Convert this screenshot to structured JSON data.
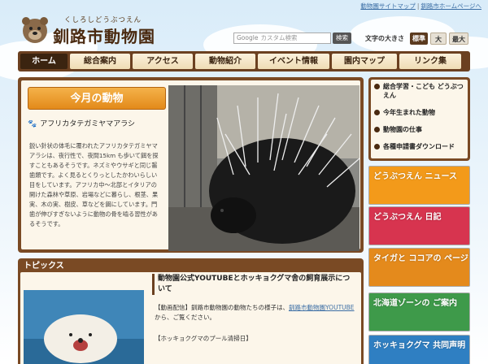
{
  "header": {
    "toplinks": [
      "動物園サイトマップ",
      "釧路市ホームページへ"
    ],
    "logo_ruby": "くしろしどうぶつえん",
    "logo_name": "釧路市動物園",
    "search_brand": "Google",
    "search_placeholder": "カスタム検索",
    "search_button": "検索",
    "fontsize_label": "文字の大きさ",
    "fontsize_options": [
      "標準",
      "大",
      "最大"
    ]
  },
  "nav": {
    "items": [
      "ホーム",
      "総合案内",
      "アクセス",
      "動物紹介",
      "イベント情報",
      "園内マップ",
      "リンク集"
    ],
    "active_index": 0
  },
  "featured": {
    "badge": "今月の動物",
    "animal_name": "アフリカタテガミヤマアラシ",
    "description": "鋭い針状の体毛に覆われたアフリカタテガミヤマアラシは、夜行性で、夜間15km も歩いて餌を探すこともあるそうです。ネズミやウサギと同じ齧歯類です。よく見るとくりっとしたかわいらしい目をしています。アフリカ中～北部とイタリアの開けた森林や草原、岩場などに暮らし、根茎、果実、木の実、樹皮、草などを餌にしています。門歯が伸びすぎないように動物の骨を嚙る習性があるそうです。"
  },
  "topics": {
    "header": "トピックス",
    "title": "動物園公式YOUTUBEとホッキョクグマ舎の飼育展示について",
    "body_prefix": "【動画配信】釧路市動物園の動物たちの様子は、",
    "body_link": "釧路市動物園YOUTUBE",
    "body_suffix": "から、ご覧ください。",
    "body2": "【ホッキョクグマのプール清掃日】"
  },
  "sidebar": {
    "menu": [
      "総合学習・こども どうぶつえん",
      "今年生まれた動物",
      "動物園の仕事",
      "各種申請書ダウンロード"
    ],
    "banners": [
      {
        "text": "どうぶつえん ニュース"
      },
      {
        "text": "どうぶつえん 日記"
      },
      {
        "text": "タイガと ココアの ページ"
      },
      {
        "text": "北海道ゾーンの ご案内"
      },
      {
        "text": "ホッキョクグマ 共同声明"
      }
    ]
  },
  "colors": {
    "nav_bg": "#6b4020",
    "nav_item": "#efdcb5",
    "accent_orange": "#e38a1a",
    "link": "#3b6ea5"
  }
}
